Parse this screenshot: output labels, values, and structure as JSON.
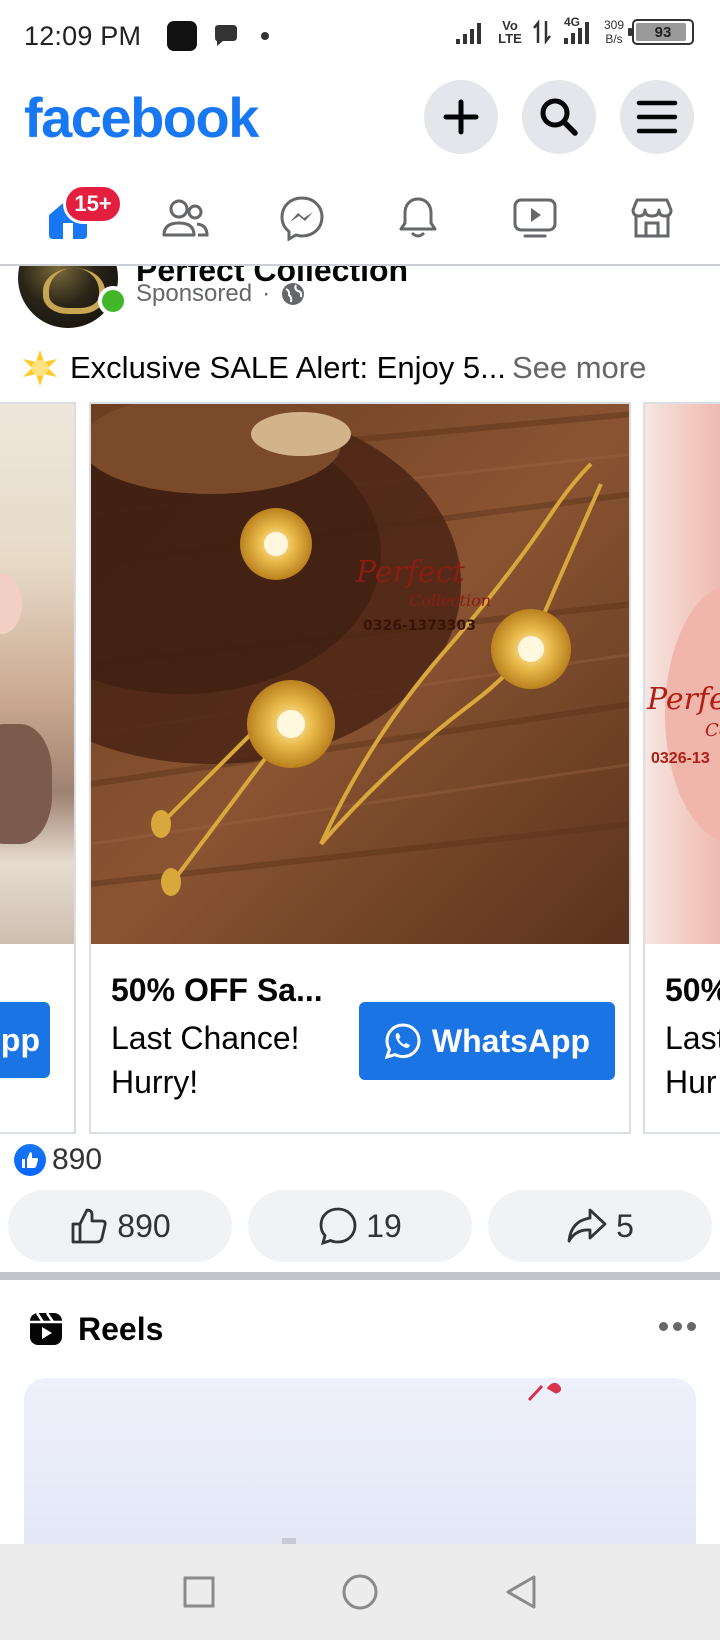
{
  "status_bar": {
    "time": "12:09 PM",
    "network_label": "Vo LTE",
    "network_type": "4G",
    "net_speed_value": "309",
    "net_speed_unit": "B/s",
    "battery_level": "93",
    "battery_fraction": 0.93
  },
  "header": {
    "logo": "facebook",
    "brand_color": "#1877f2",
    "actions": [
      "plus-icon",
      "search-icon",
      "menu-icon"
    ]
  },
  "nav": {
    "tabs": [
      "home-icon",
      "friends-icon",
      "messenger-icon",
      "notifications-icon",
      "video-icon",
      "marketplace-icon"
    ],
    "home_badge": "15+"
  },
  "post": {
    "page_name": "Perfect Collection",
    "sponsored": "Sponsored",
    "separator": "·",
    "text": "Exclusive SALE Alert: Enjoy 5...",
    "see_more": "See more",
    "cards": {
      "left": {
        "cta": "pp"
      },
      "center": {
        "image_text_1": "Perfect",
        "image_text_2": "Collection",
        "image_phone": "0326-1373303",
        "title": "50% OFF Sa...",
        "subtitle_line1": "Last Chance!",
        "subtitle_line2": "Hurry!",
        "cta": "WhatsApp"
      },
      "right": {
        "image_text_1": "Perfec",
        "image_text_2": "Co",
        "image_phone": "0326-13",
        "title": "50%",
        "subtitle_line1": "Last",
        "subtitle_line2": "Hur"
      }
    },
    "reaction_count": "890",
    "actions": {
      "like_count": "890",
      "comment_count": "19",
      "share_count": "5"
    }
  },
  "reels": {
    "title": "Reels"
  }
}
